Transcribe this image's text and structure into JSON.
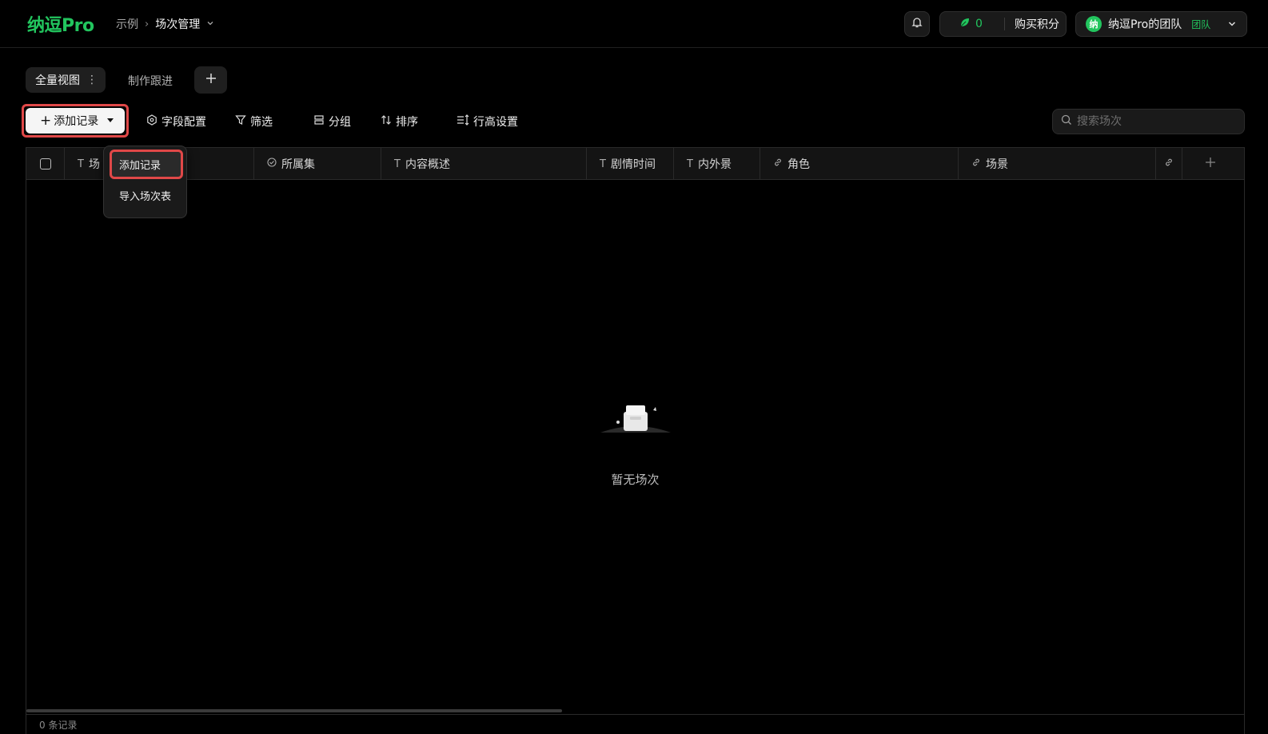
{
  "header": {
    "logo": "纳逗Pro",
    "breadcrumb": {
      "parent": "示例",
      "current": "场次管理"
    },
    "points": {
      "count": "0",
      "buy_label": "购买积分"
    },
    "team": {
      "avatar": "纳",
      "name": "纳逗Pro的团队",
      "badge": "团队"
    }
  },
  "views": {
    "tabs": [
      {
        "label": "全量视图"
      },
      {
        "label": "制作跟进"
      }
    ]
  },
  "toolbar": {
    "add_label": "添加记录",
    "fields_label": "字段配置",
    "filter_label": "筛选",
    "group_label": "分组",
    "sort_label": "排序",
    "row_height_label": "行高设置",
    "search_placeholder": "搜索场次"
  },
  "dropdown": {
    "items": [
      {
        "label": "添加记录"
      },
      {
        "label": "导入场次表"
      }
    ]
  },
  "table": {
    "columns": [
      {
        "label": "场",
        "type": "text"
      },
      {
        "label": "所属集",
        "type": "select"
      },
      {
        "label": "内容概述",
        "type": "text"
      },
      {
        "label": "剧情时间",
        "type": "text"
      },
      {
        "label": "内外景",
        "type": "text"
      },
      {
        "label": "角色",
        "type": "link"
      },
      {
        "label": "场景",
        "type": "link"
      }
    ],
    "empty_text": "暂无场次",
    "footer": "0 条记录"
  },
  "colors": {
    "brand": "#22c55e",
    "highlight": "#e04848"
  }
}
